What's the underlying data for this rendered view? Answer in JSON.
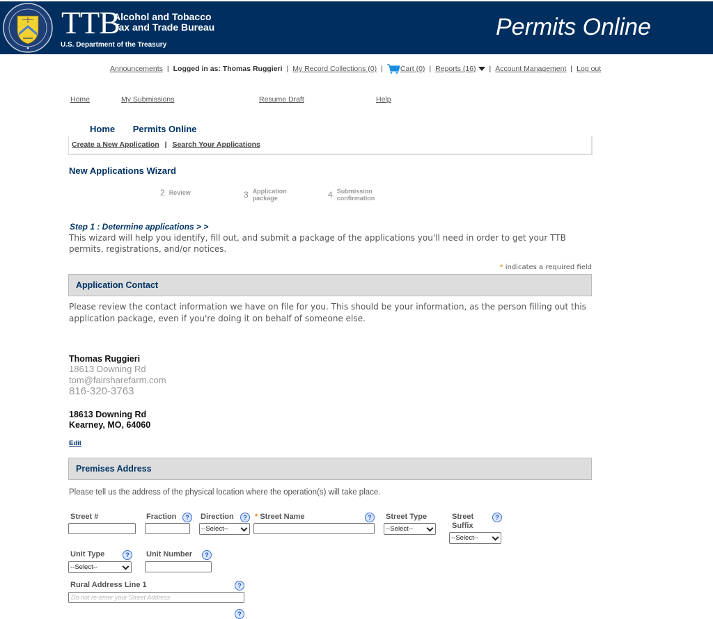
{
  "header": {
    "logo": "TTB",
    "agency_line1": "Alcohol and Tobacco",
    "agency_line2": "Tax and Trade Bureau",
    "department": "U.S. Department of the Treasury",
    "app_title": "Permits Online",
    "brand_color": "#002f5f"
  },
  "utility_bar": {
    "announcements": "Announcements",
    "logged_in_prefix": "Logged in as: Thomas Ruggieri",
    "record_collections": "My Record Collections (0)",
    "cart": "Cart (0)",
    "reports": "Reports (16)",
    "account_management": "Account Management",
    "logout": "Log out",
    "separator": "|"
  },
  "top_nav": [
    "Home",
    "My Submissions",
    "Resume Draft",
    "Help"
  ],
  "breadcrumb": [
    "Home",
    "Permits Online"
  ],
  "sub_links": {
    "create": "Create a New Application",
    "search": "Search Your Applications",
    "separator": "|"
  },
  "wizard": {
    "title": "New Applications Wizard",
    "steps": [
      {
        "num": "2",
        "label": "Review"
      },
      {
        "num": "3",
        "label": "Application package"
      },
      {
        "num": "4",
        "label": "Submission confirmation"
      }
    ],
    "current_step": "Step 1 : Determine applications > >",
    "intro": "This wizard will help you identify, fill out, and submit a package of the applications you'll need in order to get your TTB permits, registrations, and/or notices.",
    "required_note": "indicates a required field",
    "required_star": "*"
  },
  "application_contact": {
    "title": "Application Contact",
    "description": "Please review the contact information we have on file for you.  This should be your information, as the person filling out this application package, even if you're doing it on behalf of someone else.",
    "name": "Thomas  Ruggieri",
    "street": "18613 Downing Rd",
    "email": "tom@fairsharefarm.com",
    "phone": "816-320-3763",
    "address_line1": "18613 Downing Rd",
    "address_line2": "Kearney, MO, 64060",
    "edit": "Edit"
  },
  "premises_address": {
    "title": "Premises Address",
    "description": "Please tell us the address of the physical location where the operation(s) will take place.",
    "fields": {
      "street_no": {
        "label": "Street #",
        "value": ""
      },
      "fraction": {
        "label": "Fraction",
        "value": ""
      },
      "direction": {
        "label": "Direction",
        "value": "--Select--"
      },
      "street_name": {
        "label": "Street Name",
        "required": "*",
        "value": ""
      },
      "street_type": {
        "label": "Street Type",
        "value": "--Select--"
      },
      "street_suffix": {
        "label_line1": "Street",
        "label_line2": "Suffix",
        "value": "--Select--"
      },
      "unit_type": {
        "label": "Unit Type",
        "value": "--Select--"
      },
      "unit_number": {
        "label": "Unit Number",
        "value": ""
      },
      "rural_line1": {
        "label": "Rural Address Line 1",
        "placeholder": "Do not re-enter your Street Address",
        "value": ""
      }
    },
    "help_glyph": "?"
  }
}
